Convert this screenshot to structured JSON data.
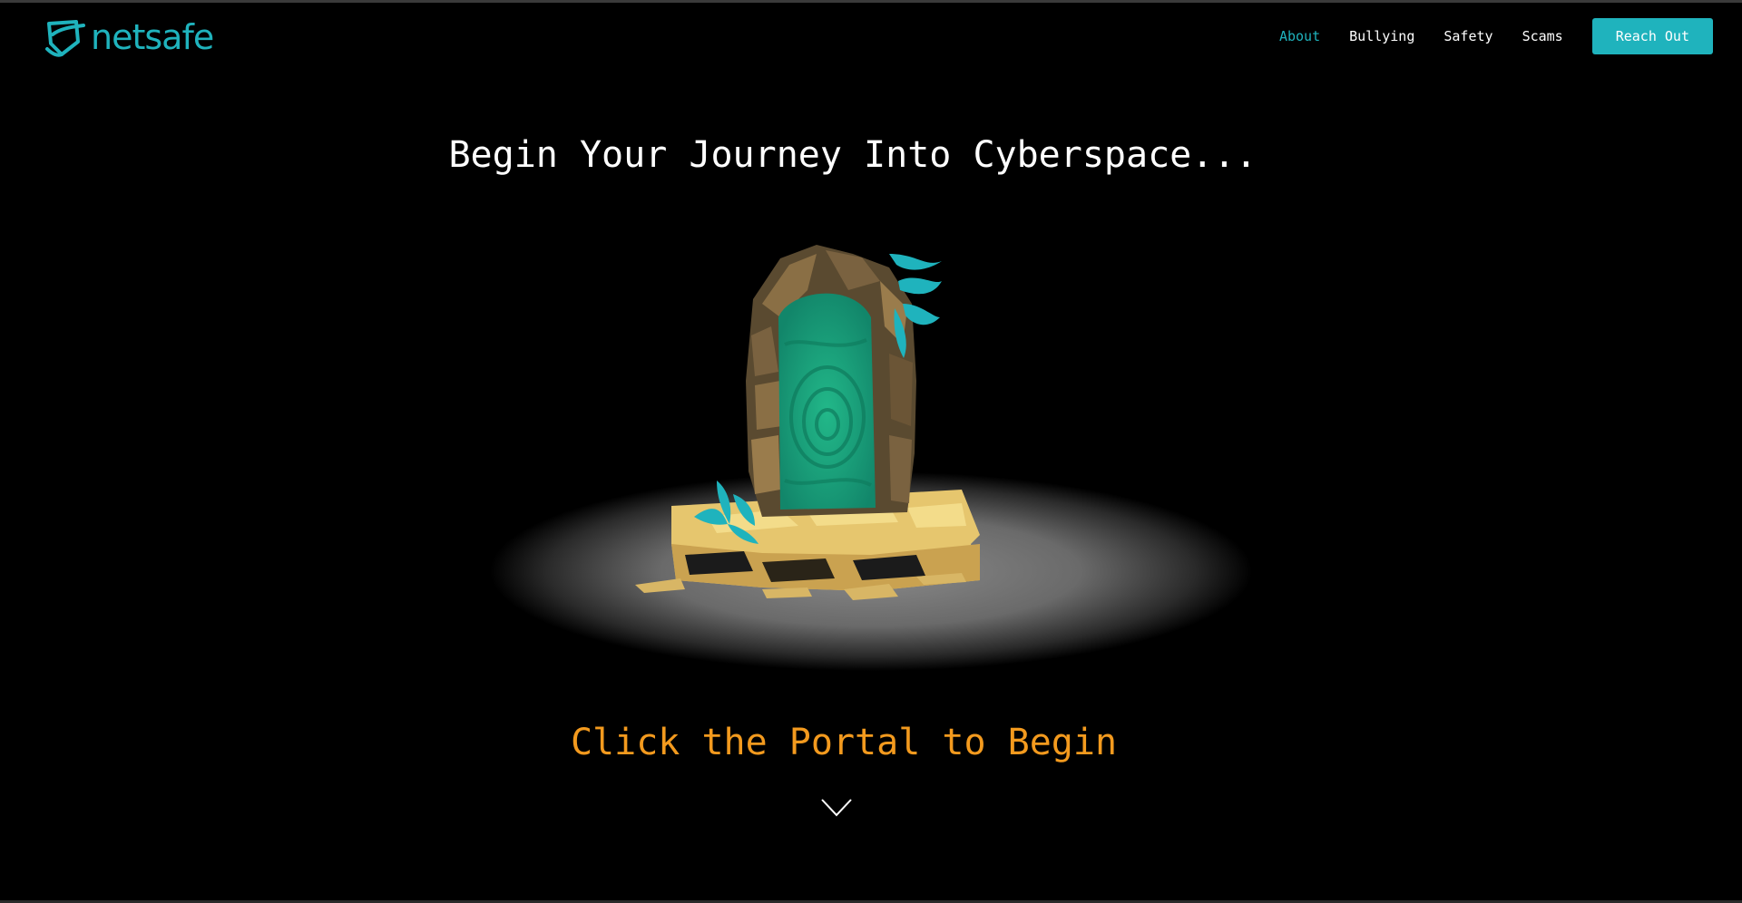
{
  "brand": {
    "name": "netsafe",
    "accent_color": "#1fb3bd",
    "icon": "netsafe-shield-logo-icon"
  },
  "nav": {
    "items": [
      {
        "label": "About",
        "active": true
      },
      {
        "label": "Bullying",
        "active": false
      },
      {
        "label": "Safety",
        "active": false
      },
      {
        "label": "Scams",
        "active": false
      }
    ],
    "cta_label": "Reach Out"
  },
  "hero": {
    "title": "Begin Your Journey Into Cyberspace...",
    "cta_text": "Click the Portal to Begin",
    "cta_color": "#f39a1e",
    "scroll_icon": "chevron-down-icon",
    "portal_icon": "portal-3d-icon"
  },
  "colors": {
    "background": "#000000",
    "portal_green": "#1fa57e",
    "stone": "#8a6f45",
    "sand": "#e6c66e"
  }
}
